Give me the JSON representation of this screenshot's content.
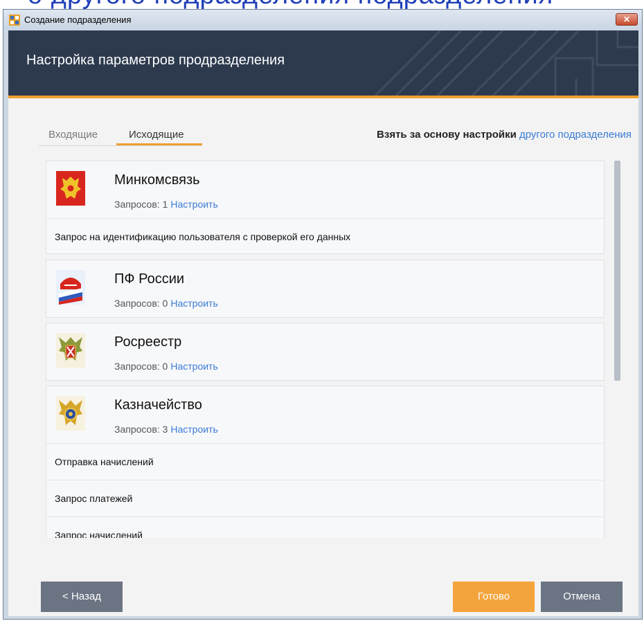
{
  "window": {
    "title": "Создание подразделения",
    "close_label": "✕"
  },
  "header": {
    "title": "Настройка параметров продразделения"
  },
  "tabs": [
    {
      "label": "Входящие",
      "active": false
    },
    {
      "label": "Исходящие",
      "active": true
    }
  ],
  "based_on": {
    "prefix": "Взять за основу настройки",
    "link": "другого подразделения"
  },
  "agencies": [
    {
      "name": "Минкомсвязь",
      "count": "Запросов: 1",
      "configure": "Настроить",
      "emblem": "russian-coat-of-arms-icon",
      "requests": [
        "Запрос на идентификацию пользователя с проверкой его данных"
      ]
    },
    {
      "name": "ПФ России",
      "count": "Запросов: 0",
      "configure": "Настроить",
      "emblem": "pension-fund-logo-icon",
      "requests": []
    },
    {
      "name": "Росреестр",
      "count": "Запросов: 0",
      "configure": "Настроить",
      "emblem": "rosreestr-emblem-icon",
      "requests": []
    },
    {
      "name": "Казначейство",
      "count": "Запросов: 3",
      "configure": "Настроить",
      "emblem": "treasury-emblem-icon",
      "requests": [
        "Отправка начислений",
        "Запрос платежей",
        "Запрос начислений"
      ]
    }
  ],
  "buttons": {
    "back": "< Назад",
    "done": "Готово",
    "cancel": "Отмена"
  },
  "colors": {
    "header_bg": "#2d3a4e",
    "accent": "#f0a030",
    "link": "#3a7bd5",
    "button_gray": "#6b7483",
    "button_orange": "#f4a43c"
  },
  "scroll": {
    "thumb_fraction": 0.58
  }
}
